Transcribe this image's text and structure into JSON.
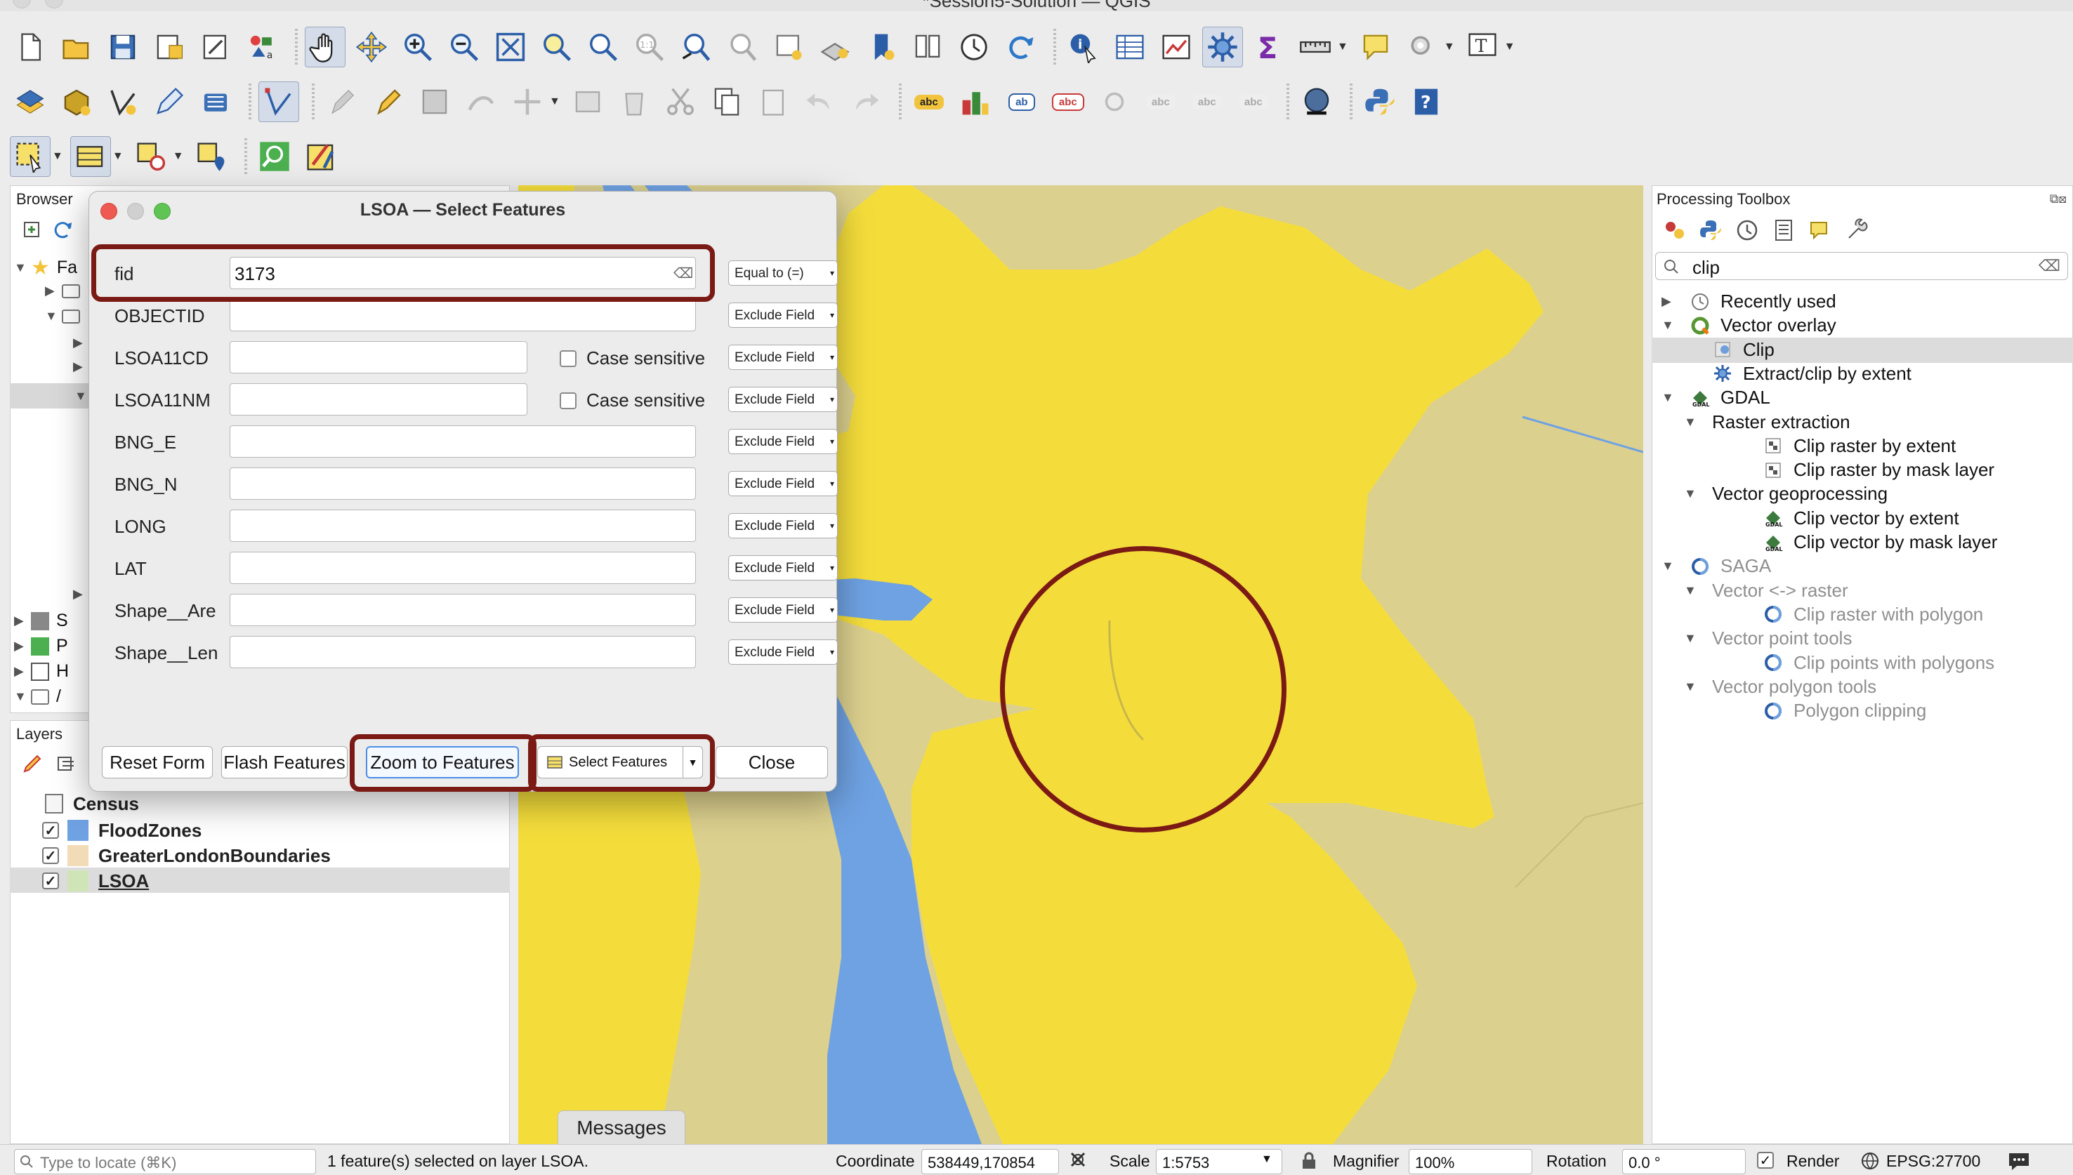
{
  "window": {
    "title": "*Session5-Solution — QGIS"
  },
  "panels": {
    "browser_title": "Browser",
    "layers_title": "Layers",
    "processing_title": "Processing Toolbox"
  },
  "browser": {
    "rows": [
      {
        "label": "Fa"
      },
      {
        "label": ""
      },
      {
        "label": ""
      },
      {
        "label": ""
      },
      {
        "label": ""
      },
      {
        "label": ""
      },
      {
        "label": "S"
      },
      {
        "label": "P"
      },
      {
        "label": "H"
      },
      {
        "label": "/"
      }
    ]
  },
  "layers": {
    "group_label": "Census",
    "items": [
      {
        "label": "FloodZones",
        "color": "#6fa2e3",
        "checked": "✓"
      },
      {
        "label": "GreaterLondonBoundaries",
        "color": "#f2dcb7",
        "checked": "✓"
      },
      {
        "label": "LSOA",
        "color": "#cfe5b8",
        "checked": "✓"
      }
    ]
  },
  "processing": {
    "search_value": "clip",
    "tree": [
      {
        "label": "Recently used",
        "level": 0,
        "gray": false
      },
      {
        "label": "Vector overlay",
        "level": 0,
        "gray": false
      },
      {
        "label": "Clip",
        "level": 1,
        "gray": false,
        "selected": true
      },
      {
        "label": "Extract/clip by extent",
        "level": 1,
        "gray": false
      },
      {
        "label": "GDAL",
        "level": 0,
        "gray": false
      },
      {
        "label": "Raster extraction",
        "level": 1,
        "gray": false
      },
      {
        "label": "Clip raster by extent",
        "level": 2,
        "gray": false
      },
      {
        "label": "Clip raster by mask layer",
        "level": 2,
        "gray": false
      },
      {
        "label": "Vector geoprocessing",
        "level": 1,
        "gray": false
      },
      {
        "label": "Clip vector by extent",
        "level": 2,
        "gray": false
      },
      {
        "label": "Clip vector by mask layer",
        "level": 2,
        "gray": false
      },
      {
        "label": "SAGA",
        "level": 0,
        "gray": true
      },
      {
        "label": "Vector <-> raster",
        "level": 1,
        "gray": true
      },
      {
        "label": "Clip raster with polygon",
        "level": 2,
        "gray": true
      },
      {
        "label": "Vector point tools",
        "level": 1,
        "gray": true
      },
      {
        "label": "Clip points with polygons",
        "level": 2,
        "gray": true
      },
      {
        "label": "Vector polygon tools",
        "level": 1,
        "gray": true
      },
      {
        "label": "Polygon clipping",
        "level": 2,
        "gray": true
      }
    ]
  },
  "dialog": {
    "title": "LSOA — Select Features",
    "fields": [
      {
        "label": "fid",
        "value": "3173",
        "operator": "Equal to (=)",
        "case_sensitive": ""
      },
      {
        "label": "OBJECTID",
        "value": "",
        "operator": "Exclude Field",
        "case_sensitive": ""
      },
      {
        "label": "LSOA11CD",
        "value": "",
        "operator": "Exclude Field",
        "case_sensitive": "Case sensitive"
      },
      {
        "label": "LSOA11NM",
        "value": "",
        "operator": "Exclude Field",
        "case_sensitive": "Case sensitive"
      },
      {
        "label": "BNG_E",
        "value": "",
        "operator": "Exclude Field",
        "case_sensitive": ""
      },
      {
        "label": "BNG_N",
        "value": "",
        "operator": "Exclude Field",
        "case_sensitive": ""
      },
      {
        "label": "LONG",
        "value": "",
        "operator": "Exclude Field",
        "case_sensitive": ""
      },
      {
        "label": "LAT",
        "value": "",
        "operator": "Exclude Field",
        "case_sensitive": ""
      },
      {
        "label": "Shape__Are",
        "value": "",
        "operator": "Exclude Field",
        "case_sensitive": ""
      },
      {
        "label": "Shape__Len",
        "value": "",
        "operator": "Exclude Field",
        "case_sensitive": ""
      }
    ],
    "buttons": {
      "reset": "Reset Form",
      "flash": "Flash Features",
      "zoom": "Zoom to Features",
      "select": "Select Features",
      "close": "Close"
    }
  },
  "messages_tab": "Messages",
  "statusbar": {
    "locate_placeholder": "Type to locate (⌘K)",
    "status_message": "1 feature(s) selected on layer LSOA.",
    "coordinate_label": "Coordinate",
    "coordinate_value": "538449,170854",
    "scale_label": "Scale",
    "scale_value": "1:5753",
    "magnifier_label": "Magnifier",
    "magnifier_value": "100%",
    "rotation_label": "Rotation",
    "rotation_value": "0.0 °",
    "render_label": "Render",
    "crs_label": "EPSG:27700"
  },
  "colors": {
    "map_background": "#dcd08e",
    "map_yellow": "#f4dd3b",
    "map_water": "#6fa2e3",
    "highlight_red": "#7b1a14"
  }
}
